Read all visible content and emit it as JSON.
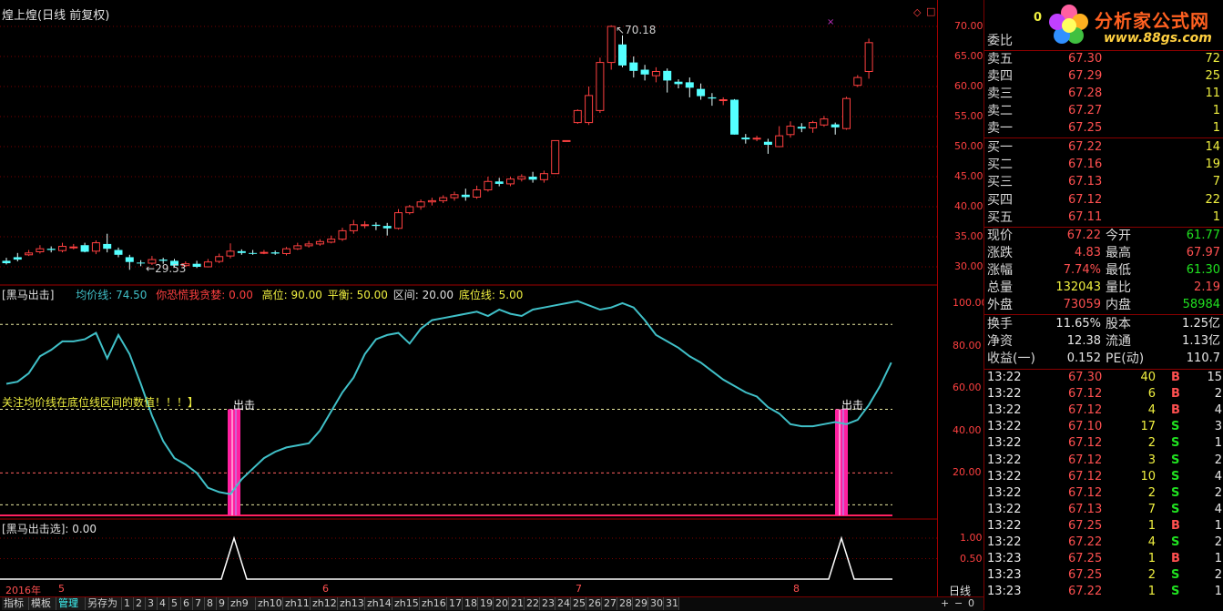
{
  "header": {
    "title": "煌上煌(日线 前复权)",
    "top_right_counter": "0"
  },
  "logo": {
    "name": "分析家公式网",
    "url": "www.88gs.com"
  },
  "price_axis": [
    "70.00",
    "65.00",
    "60.00",
    "55.00",
    "50.00",
    "45.00",
    "40.00",
    "35.00",
    "30.00"
  ],
  "price_annotations": {
    "high": "70.18",
    "low": "29.53"
  },
  "indicator_panel": {
    "name": "黑马出击",
    "avg_line": "均价线: 74.50",
    "warn": "你恐慌我贪婪: 0.00",
    "high_level": "高位: 90.00",
    "balance": "平衡: 50.00",
    "range": "区间: 20.00",
    "bottom_line": "底位线: 5.00",
    "note": "关注均价线在底位线区间的数值！！！】",
    "signal_label_1": "出击",
    "signal_label_2": "出击",
    "axis": [
      "100.00",
      "80.00",
      "60.00",
      "40.00",
      "20.00"
    ]
  },
  "signal_panel": {
    "name": "黑马出击选",
    "value": ": 0.00",
    "axis": [
      "1.00",
      "0.50"
    ]
  },
  "date_axis": {
    "year": "2016年",
    "months": [
      "5",
      "6",
      "7",
      "8"
    ],
    "period": "日线"
  },
  "bottom_tabs": [
    "指标",
    "模板",
    "管理",
    "另存为",
    "1",
    "2",
    "3",
    "4",
    "5",
    "6",
    "7",
    "8",
    "9",
    "zh9",
    "zh10",
    "zh11",
    "zh12",
    "zh13",
    "zh14",
    "zh15",
    "zh16",
    "17",
    "18",
    "19",
    "20",
    "21",
    "22",
    "23",
    "24",
    "25",
    "26",
    "27",
    "28",
    "29",
    "30",
    "31"
  ],
  "bottom_right_buttons": [
    "+",
    "−",
    "0"
  ],
  "quote": {
    "weibi_label": "委比",
    "sells": [
      {
        "label": "卖五",
        "price": "67.30",
        "vol": "72"
      },
      {
        "label": "卖四",
        "price": "67.29",
        "vol": "25"
      },
      {
        "label": "卖三",
        "price": "67.28",
        "vol": "11"
      },
      {
        "label": "卖二",
        "price": "67.27",
        "vol": "1"
      },
      {
        "label": "卖一",
        "price": "67.25",
        "vol": "1"
      }
    ],
    "buys": [
      {
        "label": "买一",
        "price": "67.22",
        "vol": "14"
      },
      {
        "label": "买二",
        "price": "67.16",
        "vol": "19"
      },
      {
        "label": "买三",
        "price": "67.13",
        "vol": "7"
      },
      {
        "label": "买四",
        "price": "67.12",
        "vol": "22"
      },
      {
        "label": "买五",
        "price": "67.11",
        "vol": "1"
      }
    ],
    "stats": [
      {
        "l1": "现价",
        "v1": "67.22",
        "c1": "red",
        "l2": "今开",
        "v2": "61.77",
        "c2": "green"
      },
      {
        "l1": "涨跌",
        "v1": "4.83",
        "c1": "red",
        "l2": "最高",
        "v2": "67.97",
        "c2": "red"
      },
      {
        "l1": "涨幅",
        "v1": "7.74%",
        "c1": "red",
        "l2": "最低",
        "v2": "61.30",
        "c2": "green"
      },
      {
        "l1": "总量",
        "v1": "132043",
        "c1": "yellow",
        "l2": "量比",
        "v2": "2.19",
        "c2": "red"
      },
      {
        "l1": "外盘",
        "v1": "73059",
        "c1": "red",
        "l2": "内盘",
        "v2": "58984",
        "c2": "green"
      }
    ],
    "fund": [
      {
        "l1": "换手",
        "v1": "11.65%",
        "l2": "股本",
        "v2": "1.25亿"
      },
      {
        "l1": "净资",
        "v1": "12.38",
        "l2": "流通",
        "v2": "1.13亿"
      },
      {
        "l1": "收益(一)",
        "v1": "0.152",
        "l2": "PE(动)",
        "v2": "110.7"
      }
    ],
    "ticks": [
      {
        "t": "13:22",
        "p": "67.30",
        "v": "40",
        "s": "B",
        "n": "15"
      },
      {
        "t": "13:22",
        "p": "67.12",
        "v": "6",
        "s": "B",
        "n": "2"
      },
      {
        "t": "13:22",
        "p": "67.12",
        "v": "4",
        "s": "B",
        "n": "4"
      },
      {
        "t": "13:22",
        "p": "67.10",
        "v": "17",
        "s": "S",
        "n": "3"
      },
      {
        "t": "13:22",
        "p": "67.12",
        "v": "2",
        "s": "S",
        "n": "1"
      },
      {
        "t": "13:22",
        "p": "67.12",
        "v": "3",
        "s": "S",
        "n": "2"
      },
      {
        "t": "13:22",
        "p": "67.12",
        "v": "10",
        "s": "S",
        "n": "4"
      },
      {
        "t": "13:22",
        "p": "67.12",
        "v": "2",
        "s": "S",
        "n": "2"
      },
      {
        "t": "13:22",
        "p": "67.13",
        "v": "7",
        "s": "S",
        "n": "4"
      },
      {
        "t": "13:22",
        "p": "67.25",
        "v": "1",
        "s": "B",
        "n": "1"
      },
      {
        "t": "13:22",
        "p": "67.22",
        "v": "4",
        "s": "S",
        "n": "2"
      },
      {
        "t": "13:23",
        "p": "67.25",
        "v": "1",
        "s": "B",
        "n": "1"
      },
      {
        "t": "13:23",
        "p": "67.25",
        "v": "2",
        "s": "S",
        "n": "2"
      },
      {
        "t": "13:23",
        "p": "67.22",
        "v": "1",
        "s": "S",
        "n": "1"
      }
    ]
  },
  "chart_data": {
    "type": "candlestick",
    "candles": [
      [
        31.0,
        30.6,
        31.5,
        30.4
      ],
      [
        31.6,
        31.2,
        32.3,
        30.9
      ],
      [
        32.0,
        32.3,
        32.8,
        31.8
      ],
      [
        32.5,
        33.0,
        33.6,
        32.2
      ],
      [
        33.0,
        32.8,
        33.4,
        32.4
      ],
      [
        32.7,
        33.4,
        34.0,
        32.4
      ],
      [
        33.3,
        33.3,
        33.8,
        32.9
      ],
      [
        33.6,
        32.5,
        34.0,
        32.4
      ],
      [
        32.6,
        34.0,
        34.4,
        32.1
      ],
      [
        33.8,
        33.0,
        35.5,
        32.4
      ],
      [
        32.8,
        32.0,
        33.2,
        31.6
      ],
      [
        31.6,
        30.8,
        32.0,
        29.5
      ],
      [
        30.7,
        30.6,
        31.1,
        30.1
      ],
      [
        30.6,
        31.2,
        31.8,
        30.3
      ],
      [
        31.2,
        31.0,
        31.5,
        30.5
      ],
      [
        31.0,
        30.2,
        31.3,
        30.0
      ],
      [
        30.2,
        30.5,
        30.9,
        30.0
      ],
      [
        30.5,
        30.0,
        31.0,
        29.8
      ],
      [
        30.0,
        30.8,
        31.3,
        29.9
      ],
      [
        30.9,
        31.7,
        32.2,
        30.6
      ],
      [
        31.8,
        32.6,
        33.9,
        31.4
      ],
      [
        32.6,
        32.3,
        32.9,
        32.0
      ],
      [
        32.3,
        32.2,
        32.8,
        32.0
      ],
      [
        32.3,
        32.4,
        32.8,
        32.1
      ],
      [
        32.4,
        32.2,
        32.7,
        32.0
      ],
      [
        32.2,
        33.0,
        33.3,
        31.9
      ],
      [
        33.0,
        33.5,
        34.0,
        32.8
      ],
      [
        33.5,
        33.8,
        34.3,
        33.2
      ],
      [
        33.8,
        34.2,
        34.6,
        33.5
      ],
      [
        34.1,
        34.6,
        35.2,
        33.9
      ],
      [
        34.6,
        36.0,
        36.5,
        34.3
      ],
      [
        36.0,
        37.0,
        37.8,
        35.5
      ],
      [
        37.0,
        37.0,
        37.6,
        36.4
      ],
      [
        37.0,
        36.8,
        37.4,
        36.1
      ],
      [
        36.8,
        36.4,
        37.3,
        35.2
      ],
      [
        36.4,
        39.0,
        39.6,
        36.2
      ],
      [
        39.0,
        40.0,
        40.3,
        38.7
      ],
      [
        40.0,
        40.8,
        41.2,
        39.5
      ],
      [
        40.8,
        41.0,
        41.5,
        40.2
      ],
      [
        41.0,
        41.5,
        41.9,
        40.6
      ],
      [
        41.5,
        42.0,
        42.5,
        41.0
      ],
      [
        42.0,
        41.6,
        43.0,
        41.0
      ],
      [
        41.6,
        42.8,
        43.5,
        41.3
      ],
      [
        42.8,
        44.2,
        45.0,
        42.5
      ],
      [
        44.2,
        43.8,
        44.8,
        43.4
      ],
      [
        43.8,
        44.6,
        45.0,
        43.4
      ],
      [
        44.6,
        45.0,
        45.4,
        44.2
      ],
      [
        45.0,
        44.5,
        45.8,
        44.0
      ],
      [
        44.5,
        45.5,
        46.0,
        44.0
      ],
      [
        45.5,
        51.0,
        51.0,
        45.5
      ],
      [
        51.0,
        51.0,
        51.0,
        51.0
      ],
      [
        54.0,
        56.0,
        56.2,
        53.8
      ],
      [
        54.0,
        58.5,
        60.0,
        53.6
      ],
      [
        56.0,
        64.0,
        64.8,
        55.6
      ],
      [
        64.0,
        70.0,
        70.18,
        62.8
      ],
      [
        67.0,
        63.5,
        68.5,
        63.2
      ],
      [
        64.0,
        62.6,
        65.0,
        61.5
      ],
      [
        62.8,
        62.0,
        63.6,
        61.0
      ],
      [
        61.8,
        62.5,
        63.2,
        60.7
      ],
      [
        62.6,
        61.0,
        63.0,
        59.0
      ],
      [
        60.8,
        60.4,
        61.2,
        59.7
      ],
      [
        60.7,
        59.8,
        61.5,
        58.2
      ],
      [
        59.6,
        58.4,
        60.5,
        57.8
      ],
      [
        58.2,
        58.0,
        58.9,
        56.8
      ],
      [
        57.7,
        57.8,
        58.2,
        56.9
      ],
      [
        57.8,
        52.0,
        57.9,
        52.0
      ],
      [
        51.5,
        51.2,
        52.1,
        50.5
      ],
      [
        51.3,
        51.4,
        51.8,
        50.9
      ],
      [
        50.8,
        50.3,
        51.3,
        48.8
      ],
      [
        50.0,
        51.8,
        53.4,
        49.9
      ],
      [
        52.0,
        53.4,
        54.2,
        51.5
      ],
      [
        53.3,
        53.0,
        53.9,
        52.4
      ],
      [
        53.1,
        54.0,
        54.3,
        52.3
      ],
      [
        53.6,
        54.6,
        55.1,
        53.3
      ],
      [
        53.7,
        53.2,
        54.0,
        52.0
      ],
      [
        53.0,
        58.0,
        58.3,
        52.8
      ],
      [
        60.2,
        61.5,
        61.9,
        59.9
      ],
      [
        62.5,
        67.3,
        67.97,
        61.3
      ]
    ],
    "oscillator": [
      62,
      63,
      67,
      75,
      78,
      82,
      82,
      83,
      86,
      74,
      85,
      76,
      62,
      47,
      35,
      27,
      24,
      20,
      13,
      11,
      10,
      17,
      22,
      27,
      30,
      32,
      33,
      34,
      40,
      49,
      58,
      65,
      76,
      83,
      85,
      86,
      81,
      88,
      92,
      93,
      94,
      95,
      96,
      94,
      97,
      95,
      94,
      97,
      98,
      99,
      100,
      101,
      99,
      97,
      98,
      100,
      98,
      92,
      85,
      82,
      79,
      75,
      72,
      68,
      64,
      61,
      58,
      56,
      51,
      48,
      43,
      42,
      42,
      43,
      44,
      43,
      45,
      52,
      61,
      72
    ]
  }
}
